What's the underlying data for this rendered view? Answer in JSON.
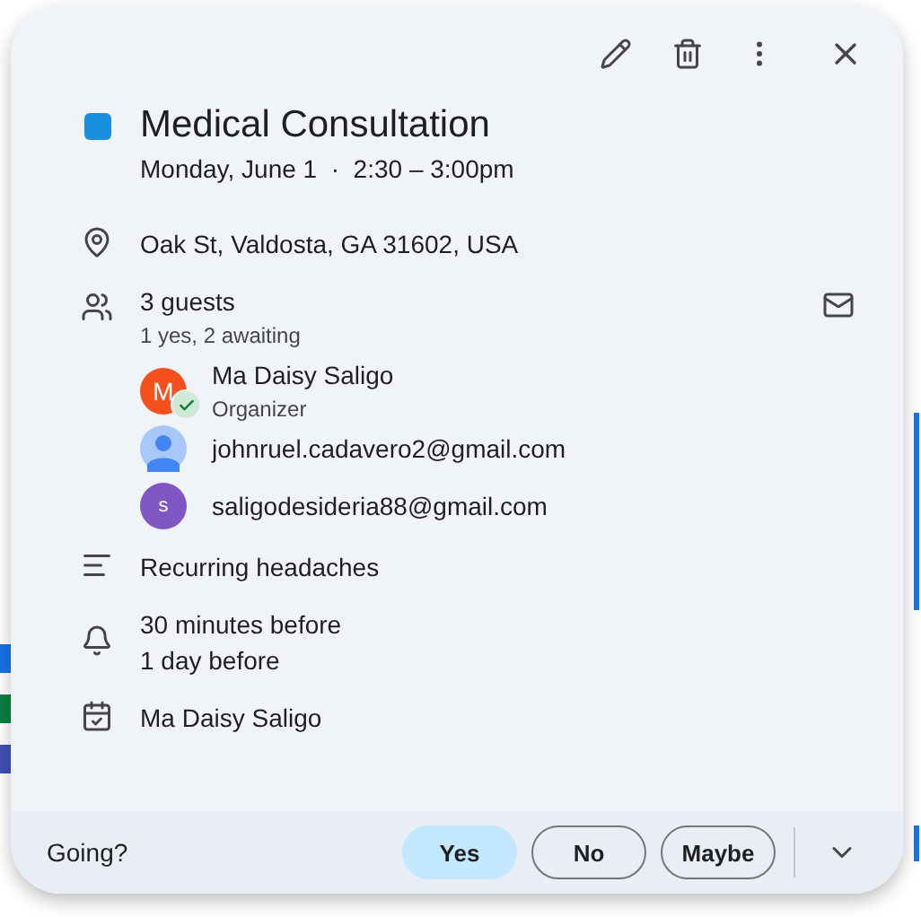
{
  "event": {
    "title": "Medical Consultation",
    "when": "Monday, June 1  ·  2:30 – 3:00pm"
  },
  "location": "Oak St, Valdosta, GA 31602, USA",
  "guests": {
    "summary": "3 guests",
    "detail": "1 yes, 2 awaiting",
    "list": [
      {
        "name": "Ma Daisy Saligo",
        "role": "Organizer",
        "kind": "letter",
        "letter": "M",
        "color": "#f4511e",
        "accepted": true
      },
      {
        "name": "johnruel.cadavero2@gmail.com",
        "kind": "person",
        "accepted": false
      },
      {
        "name": "saligodesideria88@gmail.com",
        "kind": "letter",
        "letter": "s",
        "color": "#7e57c2",
        "accepted": false
      }
    ]
  },
  "description": "Recurring headaches",
  "reminders": [
    "30 minutes before",
    "1 day before"
  ],
  "calendar": "Ma Daisy Saligo",
  "rsvp": {
    "prompt": "Going?",
    "options": [
      {
        "label": "Yes",
        "selected": true
      },
      {
        "label": "No",
        "selected": false
      },
      {
        "label": "Maybe",
        "selected": false
      }
    ]
  }
}
